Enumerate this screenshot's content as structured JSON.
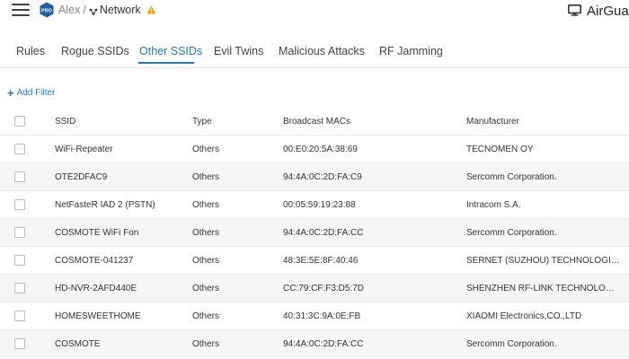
{
  "topbar": {
    "pro_badge": "PRO",
    "breadcrumb_user": "Alex",
    "breadcrumb_sep": "/",
    "breadcrumb_network": "Network",
    "app_name": "AirGuard",
    "accent": "#1f7ab8",
    "warning_color": "#f0a500"
  },
  "tabs": [
    {
      "label": "Rules",
      "active": false
    },
    {
      "label": "Rogue SSIDs",
      "active": false
    },
    {
      "label": "Other SSIDs",
      "active": true
    },
    {
      "label": "Evil Twins",
      "active": false
    },
    {
      "label": "Malicious Attacks",
      "active": false
    },
    {
      "label": "RF Jamming",
      "active": false
    }
  ],
  "filter": {
    "add_label": "Add Filter"
  },
  "table": {
    "headers": {
      "ssid": "SSID",
      "type": "Type",
      "mac": "Broadcast MACs",
      "manufacturer": "Manufacturer"
    },
    "rows": [
      {
        "ssid": "WiFi-Repeater",
        "type": "Others",
        "mac": "00:E0:20:5A:38:69",
        "manufacturer": "TECNOMEN OY"
      },
      {
        "ssid": "OTE2DFAC9",
        "type": "Others",
        "mac": "94:4A:0C:2D:FA:C9",
        "manufacturer": "Sercomm Corporation."
      },
      {
        "ssid": "NetFasteR IAD 2 (PSTN)",
        "type": "Others",
        "mac": "00:05:59:19:23:88",
        "manufacturer": "Intracom S.A."
      },
      {
        "ssid": "COSMOTE WiFi Fon",
        "type": "Others",
        "mac": "94:4A:0C:2D:FA:CC",
        "manufacturer": "Sercomm Corporation."
      },
      {
        "ssid": "COSMOTE-041237",
        "type": "Others",
        "mac": "48:3E:5E:8F:40:46",
        "manufacturer": "SERNET (SUZHOU) TECHNOLOGIES ..."
      },
      {
        "ssid": "HD-NVR-2AFD440E",
        "type": "Others",
        "mac": "CC:79:CF:F3:D5:7D",
        "manufacturer": "SHENZHEN RF-LINK TECHNOLOGY ..."
      },
      {
        "ssid": "HOMESWEETHOME",
        "type": "Others",
        "mac": "40:31:3C:9A:0E:FB",
        "manufacturer": "XIAOMI Electronics,CO.,LTD"
      },
      {
        "ssid": "COSMOTE",
        "type": "Others",
        "mac": "94:4A:0C:2D:FA:CC",
        "manufacturer": "Sercomm Corporation."
      }
    ]
  }
}
